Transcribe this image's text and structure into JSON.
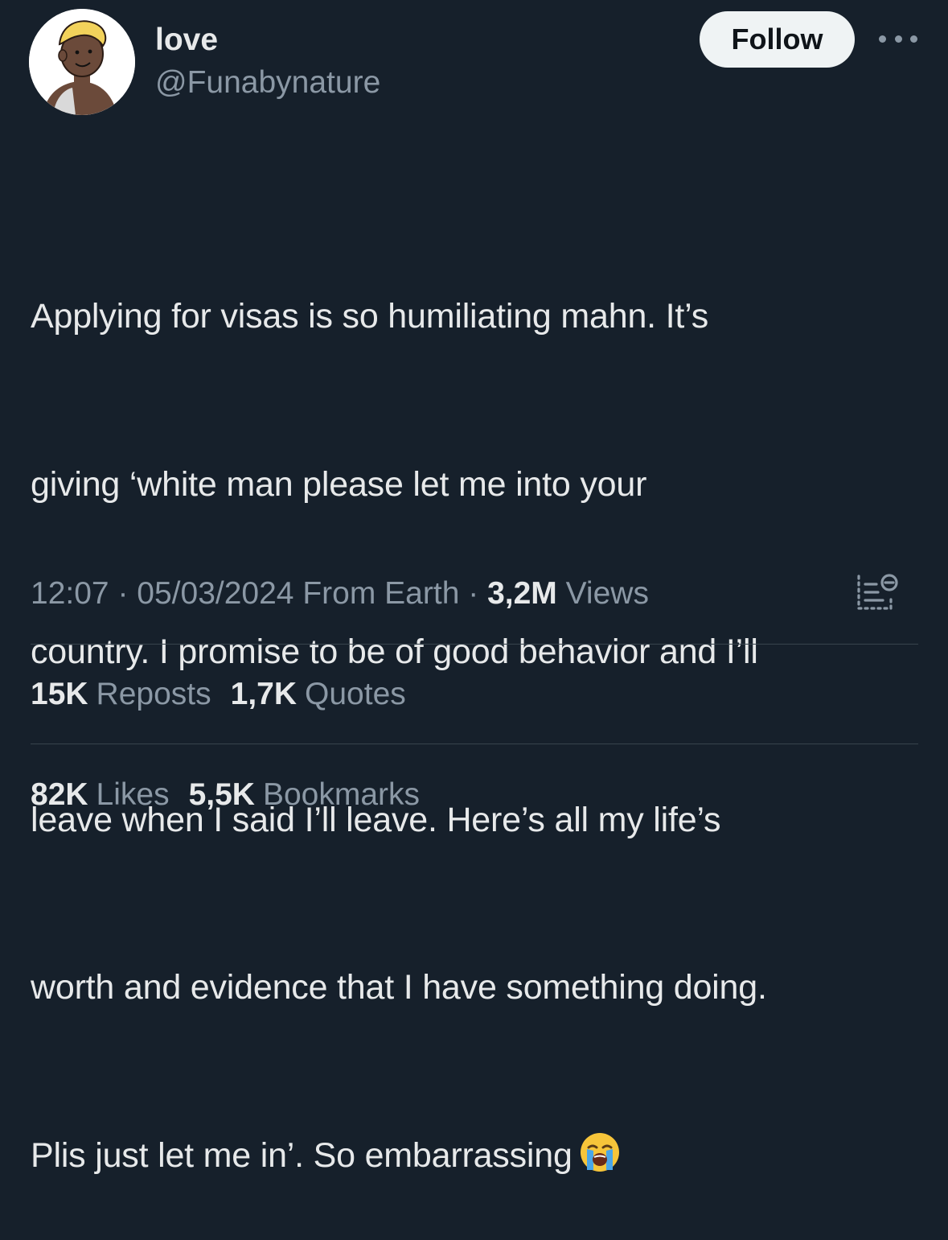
{
  "author": {
    "display_name": "love",
    "handle": "@Funabynature",
    "avatar_icon": "cartoon-avatar"
  },
  "actions": {
    "follow_label": "Follow",
    "more_icon": "more-horizontal-icon"
  },
  "tweet": {
    "lines": [
      "Applying for visas is so humiliating mahn. It’s",
      "giving ‘white man please let me into your",
      "country. I promise to be of good behavior and I’ll",
      "leave when I said I’ll leave. Here’s all my life’s",
      "worth and evidence that I have something doing.",
      "Plis just let me in’. So embarrassing"
    ],
    "emoji": "loudly-crying-face-emoji"
  },
  "meta": {
    "time": "12:07",
    "separator": "·",
    "date": "05/03/2024",
    "location": "From Earth",
    "views_count": "3,2M",
    "views_label": "Views",
    "analytics_icon": "analytics-icon"
  },
  "stats": {
    "reposts": {
      "count": "15K",
      "label": "Reposts"
    },
    "quotes": {
      "count": "1,7K",
      "label": "Quotes"
    },
    "likes": {
      "count": "82K",
      "label": "Likes"
    },
    "bookmarks": {
      "count": "5,5K",
      "label": "Bookmarks"
    }
  },
  "colors": {
    "background": "#16202b",
    "text_primary": "#e7e9ea",
    "text_secondary": "#8b98a5",
    "follow_bg": "#eff3f4",
    "divider": "#38444d"
  }
}
